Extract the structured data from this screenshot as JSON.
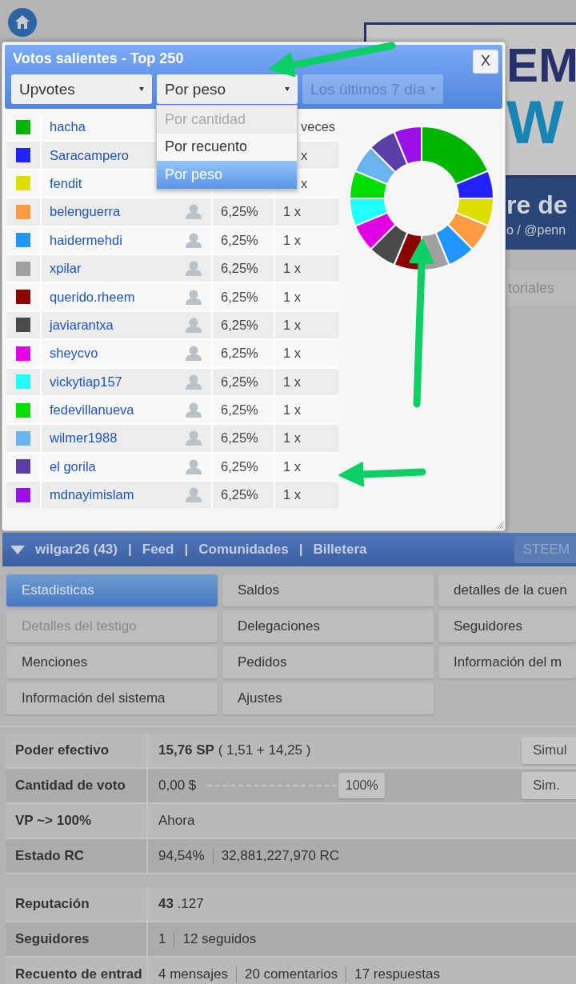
{
  "background": {
    "banner_texts": [
      "EM",
      "W"
    ],
    "band_texts": [
      "re de",
      "o / @penn"
    ],
    "tab_label": "toriales"
  },
  "modal": {
    "title": "Votos salientes - Top 250",
    "close": "X",
    "filters": [
      {
        "value": "Upvotes",
        "disabled": false,
        "open": false
      },
      {
        "value": "Por peso",
        "disabled": false,
        "open": true
      },
      {
        "value": "Los últimos 7 día",
        "disabled": true,
        "open": false
      }
    ],
    "dropdown_options": [
      {
        "label": "Por cantidad",
        "disabled": true,
        "selected": false
      },
      {
        "label": "Por recuento",
        "disabled": false,
        "selected": false
      },
      {
        "label": "Por peso",
        "disabled": false,
        "selected": true
      }
    ],
    "rows": [
      {
        "name": "hacha",
        "color": "#00b400",
        "count": "veces"
      },
      {
        "name": "Saracampero",
        "color": "#2222ff",
        "count": "x"
      },
      {
        "name": "fendit",
        "color": "#dddd00",
        "count": "x"
      },
      {
        "name": "belenguerra",
        "color": "#ff9944",
        "percent": "6,25%",
        "count": "1 x"
      },
      {
        "name": "haidermehdi",
        "color": "#2196ff",
        "percent": "6,25%",
        "count": "1 x"
      },
      {
        "name": "xpilar",
        "color": "#a0a0a0",
        "percent": "6,25%",
        "count": "1 x"
      },
      {
        "name": "querido.rheem",
        "color": "#8b0000",
        "percent": "6,25%",
        "count": "1 x"
      },
      {
        "name": "javiarantxa",
        "color": "#4a4a4a",
        "percent": "6,25%",
        "count": "1 x"
      },
      {
        "name": "sheycvo",
        "color": "#e000e8",
        "percent": "6,25%",
        "count": "1 x"
      },
      {
        "name": "vickytiap157",
        "color": "#22ffff",
        "percent": "6,25%",
        "count": "1 x"
      },
      {
        "name": "fedevillanueva",
        "color": "#00dd00",
        "percent": "6,25%",
        "count": "1 x"
      },
      {
        "name": "wilmer1988",
        "color": "#6ab4f0",
        "percent": "6,25%",
        "count": "1 x"
      },
      {
        "name": "el gorila",
        "color": "#5b3ea8",
        "percent": "6,25%",
        "count": "1 x"
      },
      {
        "name": "mdnayimislam",
        "color": "#9a10e6",
        "percent": "6,25%",
        "count": "1 x"
      }
    ]
  },
  "nav": {
    "user": "wilgar26 (43)",
    "links": [
      {
        "separator": "|",
        "label": "Feed"
      },
      {
        "separator": "|",
        "label": "Comunidades"
      },
      {
        "separator": "|",
        "label": "Billetera"
      }
    ],
    "button": "STEEM"
  },
  "menu": [
    {
      "label": "Estadisticas",
      "selected": true,
      "disabled": false
    },
    {
      "label": "Saldos",
      "selected": false,
      "disabled": false
    },
    {
      "label": "detalles de la cuen",
      "selected": false,
      "disabled": false
    },
    {
      "label": "Detalles del testigo",
      "selected": false,
      "disabled": true
    },
    {
      "label": "Delegaciones",
      "selected": false,
      "disabled": false
    },
    {
      "label": "Seguidores",
      "selected": false,
      "disabled": false
    },
    {
      "label": "Menciones",
      "selected": false,
      "disabled": false
    },
    {
      "label": "Pedidos",
      "selected": false,
      "disabled": false
    },
    {
      "label": "Información del m",
      "selected": false,
      "disabled": false
    },
    {
      "label": "Información del sistema",
      "selected": false,
      "disabled": false
    },
    {
      "label": "Ajustes",
      "selected": false,
      "disabled": false
    }
  ],
  "stats": {
    "groups": [
      [
        {
          "kind": "text",
          "label": "Poder efectivo",
          "value": "**15,76 SP** ( 1,51 + 14,25 )",
          "button": "Simul"
        },
        {
          "kind": "slider",
          "label": "Cantidad de voto",
          "value": "0,00 $",
          "level": 1,
          "reading": "100%",
          "button": "Sim."
        },
        {
          "kind": "text",
          "label": "VP ~> 100%",
          "value": "Ahora"
        },
        {
          "kind": "split",
          "label": "Estado RC",
          "values": [
            "94,54%",
            "32,881,227,970 RC"
          ]
        }
      ],
      [
        {
          "kind": "text",
          "label": "Reputación",
          "value": "**43** .127"
        },
        {
          "kind": "split",
          "label": "Seguidores",
          "values": [
            "1",
            "12 seguidos"
          ]
        },
        {
          "kind": "split",
          "label": "Recuento de entrad",
          "values": [
            "4 mensajes",
            "20 comentarios",
            "17 respuestas"
          ]
        }
      ]
    ]
  }
}
